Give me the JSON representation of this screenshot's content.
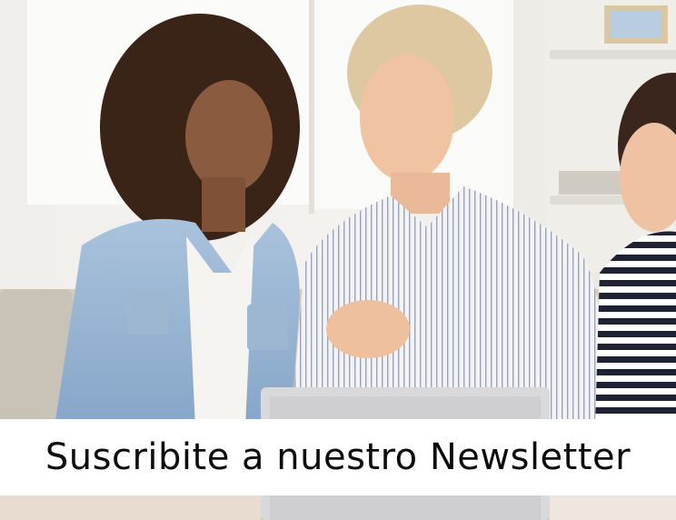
{
  "newsletter_banner": {
    "caption": "Suscribite a nuestro Newsletter"
  },
  "colors": {
    "caption_bar": "#ffffff",
    "caption_text": "#0d0d0d",
    "background_wall": "#ece9e4",
    "sofa": "#d7d1c7",
    "laptop": "#dcdcdc"
  }
}
